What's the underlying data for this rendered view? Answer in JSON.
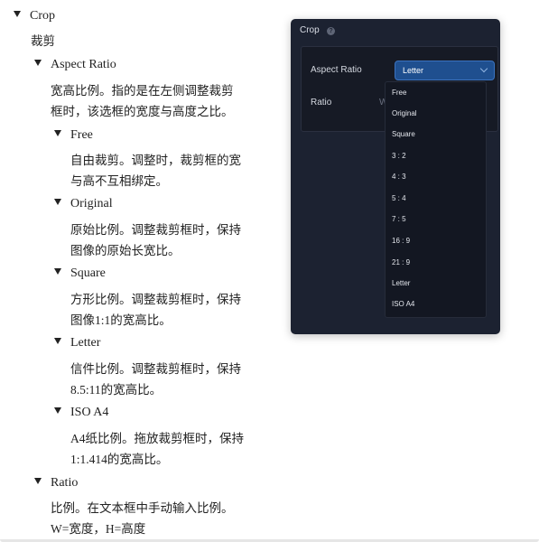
{
  "doc": {
    "crop": {
      "title": "Crop",
      "desc": "裁剪"
    },
    "aspect_ratio": {
      "title": "Aspect Ratio",
      "desc_lines": [
        "宽高比例。指的是在左侧调整裁剪",
        "框时，该选框的宽度与高度之比。"
      ]
    },
    "options": [
      {
        "title": "Free",
        "desc_lines": [
          "自由裁剪。调整时，裁剪框的宽",
          "与高不互相绑定。"
        ]
      },
      {
        "title": "Original",
        "desc_lines": [
          "原始比例。调整裁剪框时，保持",
          "图像的原始长宽比。"
        ]
      },
      {
        "title": "Square",
        "desc_lines": [
          "方形比例。调整裁剪框时，保持",
          "图像1:1的宽高比。"
        ]
      },
      {
        "title": "Letter",
        "desc_lines": [
          "信件比例。调整裁剪框时，保持",
          "8.5:11的宽高比。"
        ]
      },
      {
        "title": "ISO A4",
        "desc_lines": [
          "A4纸比例。拖放裁剪框时，保持",
          "1:1.414的宽高比。"
        ]
      }
    ],
    "ratio": {
      "title": "Ratio",
      "desc_lines": [
        "比例。在文本框中手动输入比例。",
        "W=宽度，H=高度"
      ]
    }
  },
  "panel": {
    "title": "Crop",
    "help_icon": "?",
    "aspect_ratio_label": "Aspect Ratio",
    "selected": "Letter",
    "ratio_label": "Ratio",
    "ratio_partial": "W",
    "dropdown_options": [
      "Free",
      "Original",
      "Square",
      "3 : 2",
      "4 : 3",
      "5 : 4",
      "7 : 5",
      "16 : 9",
      "21 : 9",
      "Letter",
      "ISO A4"
    ],
    "colors": {
      "panel_bg": "#1c2231",
      "select_bg": "#1f4f8f",
      "dropdown_bg": "#131722"
    }
  }
}
